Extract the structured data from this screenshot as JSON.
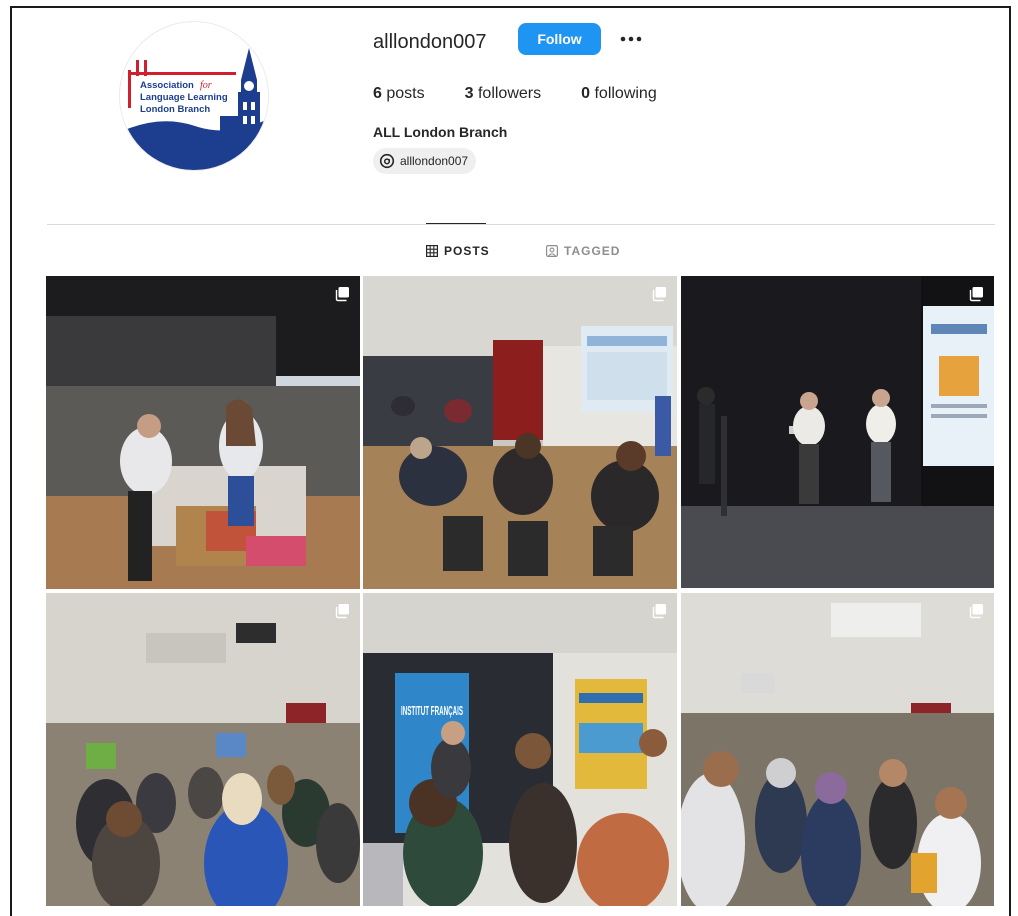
{
  "profile": {
    "username": "alllondon007",
    "follow_label": "Follow",
    "stats": {
      "posts_count": "6",
      "posts_label": "posts",
      "followers_count": "3",
      "followers_label": "followers",
      "following_count": "0",
      "following_label": "following"
    },
    "full_name": "ALL London Branch",
    "threads_handle": "alllondon007",
    "logo": {
      "line1": "Association",
      "for": "for",
      "line2": "Language Learning",
      "line3": "London Branch"
    }
  },
  "tabs": [
    {
      "label": "POSTS",
      "icon": "grid-icon",
      "active": true
    },
    {
      "label": "TAGGED",
      "icon": "tagged-icon",
      "active": false
    }
  ],
  "posts": [
    {
      "subject": "exhibition-stand",
      "multi": true
    },
    {
      "subject": "seminar-room-presentation",
      "multi": true
    },
    {
      "subject": "stage-speakers",
      "multi": true
    },
    {
      "subject": "crowded-hall",
      "multi": true
    },
    {
      "subject": "institut-francais-stand",
      "multi": true,
      "banner_text": "INSTITUT FRANÇAIS"
    },
    {
      "subject": "networking-crowd",
      "multi": true
    }
  ],
  "colors": {
    "follow_button": "#1e95f2",
    "logo_red": "#d0202e",
    "logo_blue": "#1d3e8f"
  }
}
